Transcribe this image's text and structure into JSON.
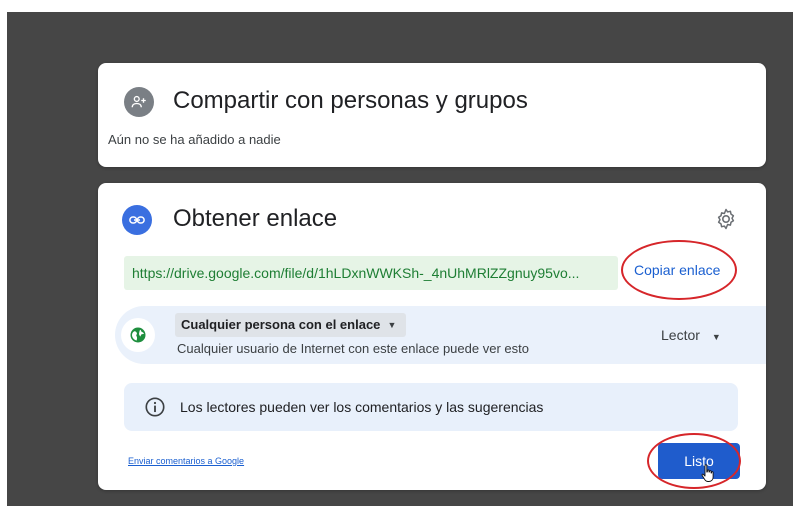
{
  "colors": {
    "backdrop": "#464646",
    "accent": "#1f5ccc",
    "url_background": "#e6f4e6",
    "url_text": "#1e7e34",
    "highlight_ring": "#d6262a"
  },
  "people_section": {
    "icon": "person-add-icon",
    "title": "Compartir con personas y grupos",
    "subtitle": "Aún no se ha añadido a nadie"
  },
  "link_section": {
    "icon": "link-icon",
    "title": "Obtener enlace",
    "settings_icon": "gear-icon",
    "url": "https://drive.google.com/file/d/1hLDxnWWKSh-_4nUhMRlZZgnuy95vo...",
    "copy_label": "Copiar enlace",
    "access": {
      "icon": "globe-icon",
      "scope": "Cualquier persona con el enlace",
      "description": "Cualquier usuario de Internet con este enlace puede ver esto",
      "role": "Lector"
    },
    "info": {
      "icon": "info-icon",
      "text": "Los lectores pueden ver los comentarios y las sugerencias"
    },
    "feedback_label": "Enviar comentarios a Google",
    "done_label": "Listo"
  }
}
